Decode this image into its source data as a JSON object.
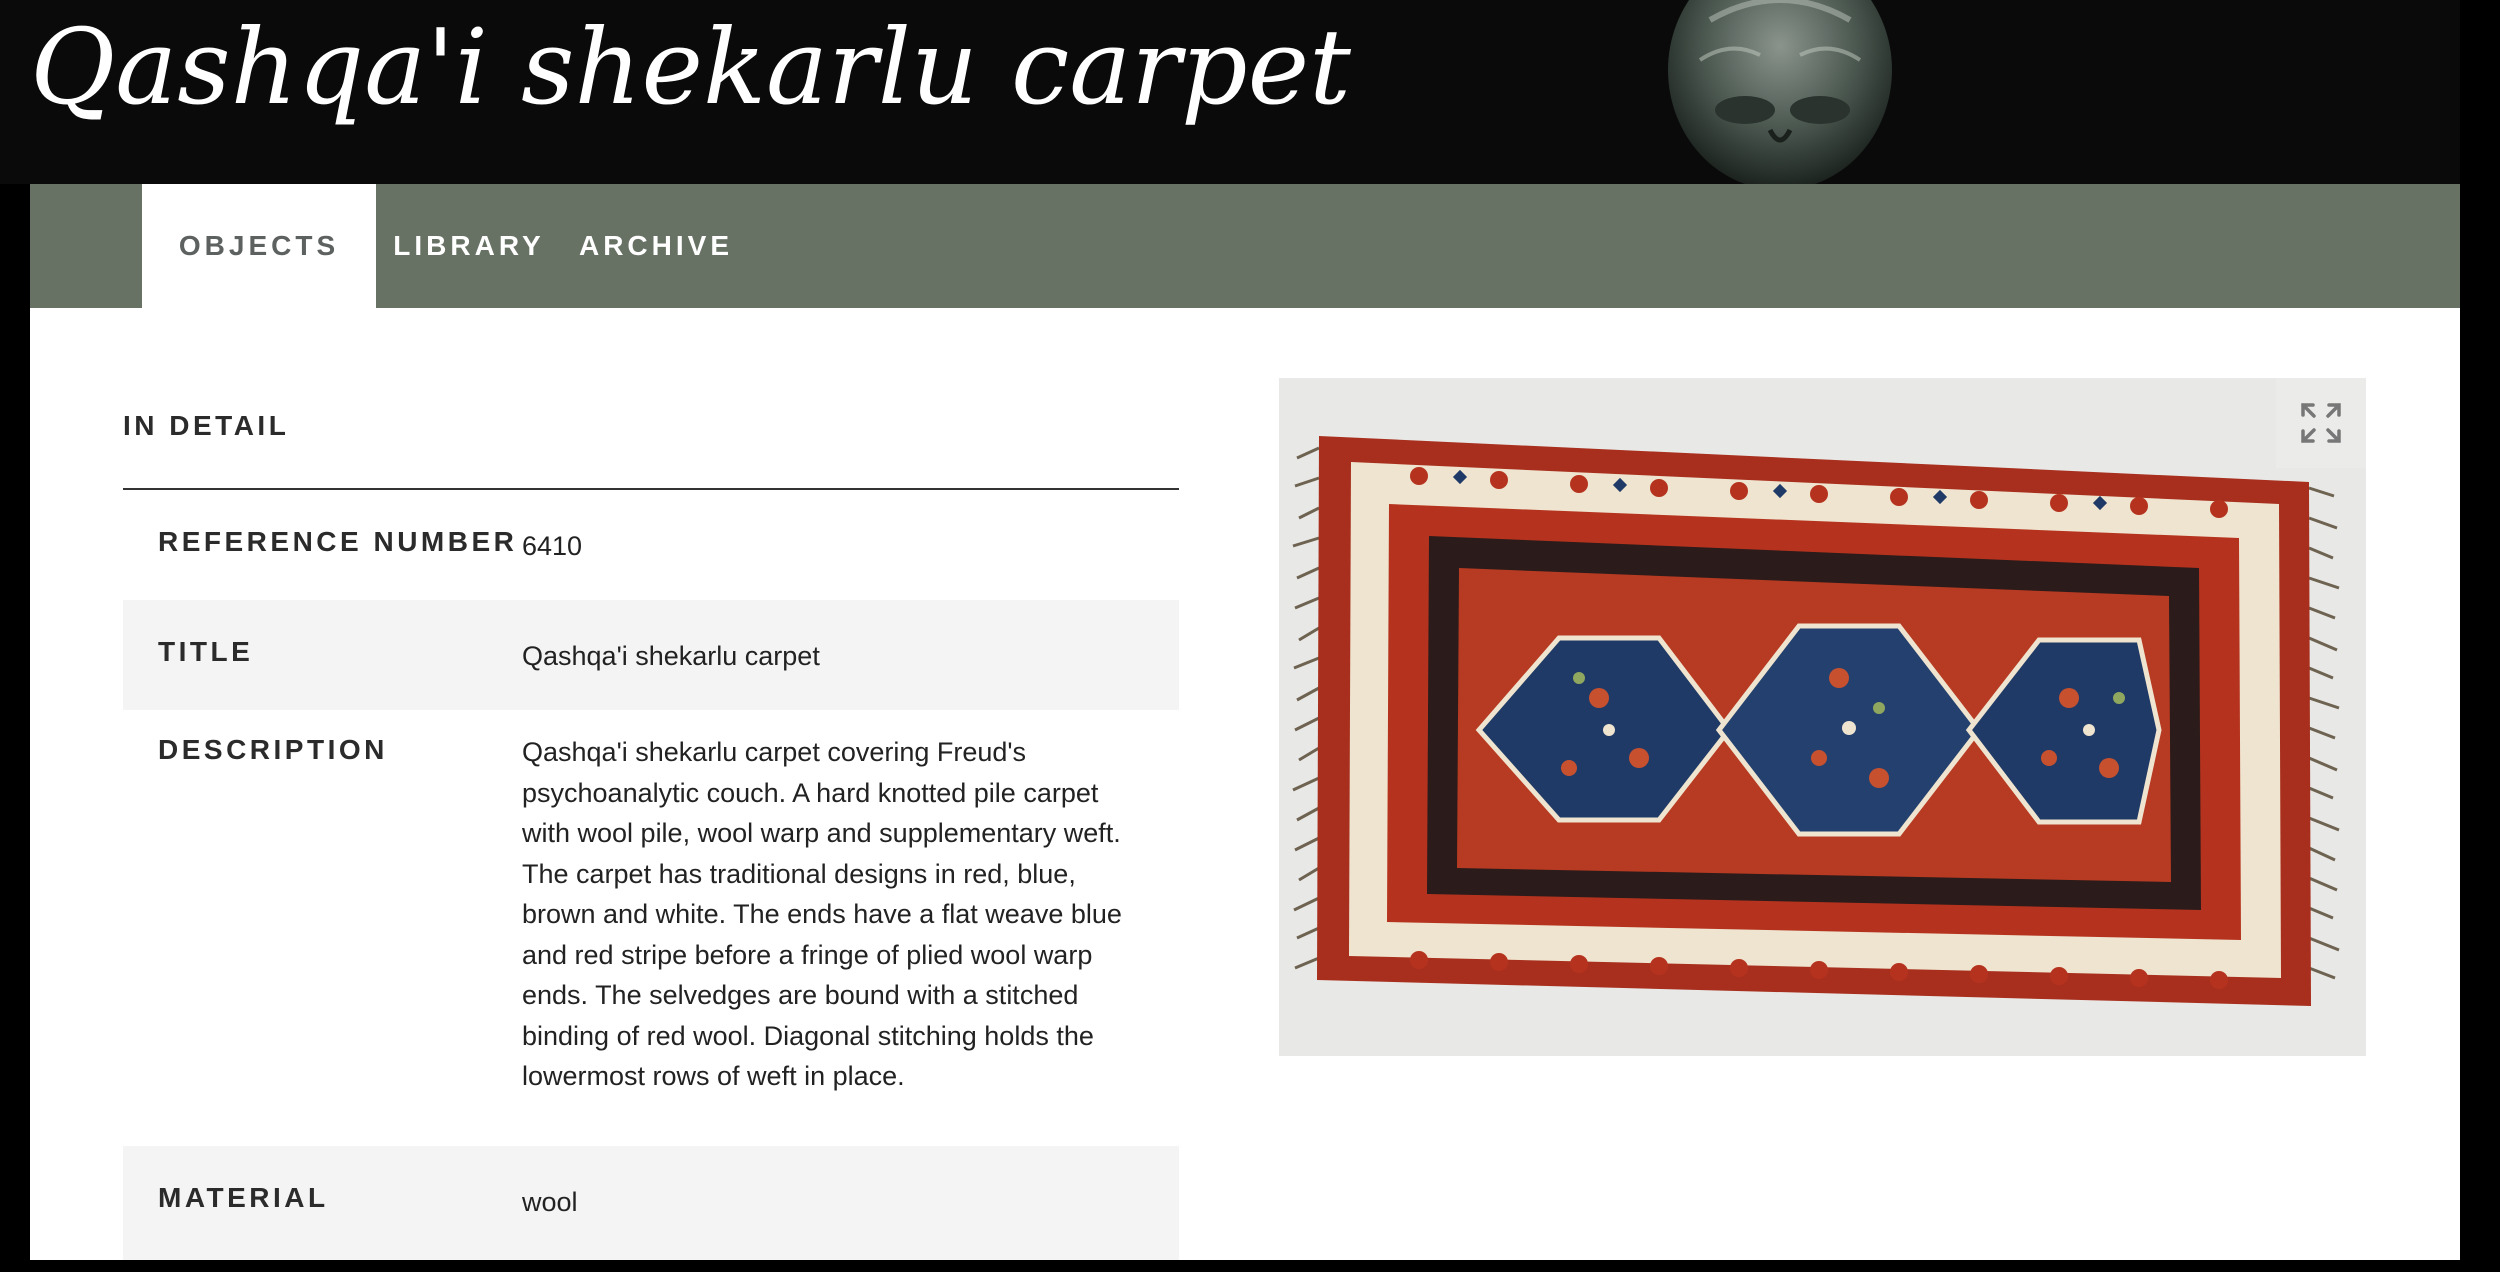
{
  "header": {
    "title": "Qashqa'i shekarlu carpet"
  },
  "nav": {
    "tabs": [
      {
        "label": "OBJECTS",
        "active": true
      },
      {
        "label": "LIBRARY",
        "active": false
      },
      {
        "label": "ARCHIVE",
        "active": false
      }
    ]
  },
  "detail": {
    "section_title": "IN DETAIL",
    "rows": [
      {
        "label": "REFERENCE NUMBER",
        "value": "6410"
      },
      {
        "label": "TITLE",
        "value": "Qashqa'i shekarlu carpet"
      },
      {
        "label": "DESCRIPTION",
        "value": "Qashqa'i shekarlu carpet covering Freud's psychoanalytic couch. A hard knotted pile carpet with wool pile, wool warp and supplementary weft. The carpet has traditional designs in red, blue, brown and white. The ends have a flat weave blue and red stripe before a fringe of plied wool warp ends. The selvedges are bound with a stitched binding of red wool. Diagonal stitching holds the lowermost rows of weft in place."
      },
      {
        "label": "MATERIAL",
        "value": "wool"
      }
    ]
  },
  "viewer": {
    "expand_icon": "expand-icon"
  },
  "colors": {
    "nav_bg": "#677264",
    "hero_bg": "#0a0a0b",
    "row_shade": "#f4f4f4",
    "carpet_red": "#b5331e",
    "carpet_blue": "#1f3a66",
    "carpet_cream": "#efe4cf"
  }
}
